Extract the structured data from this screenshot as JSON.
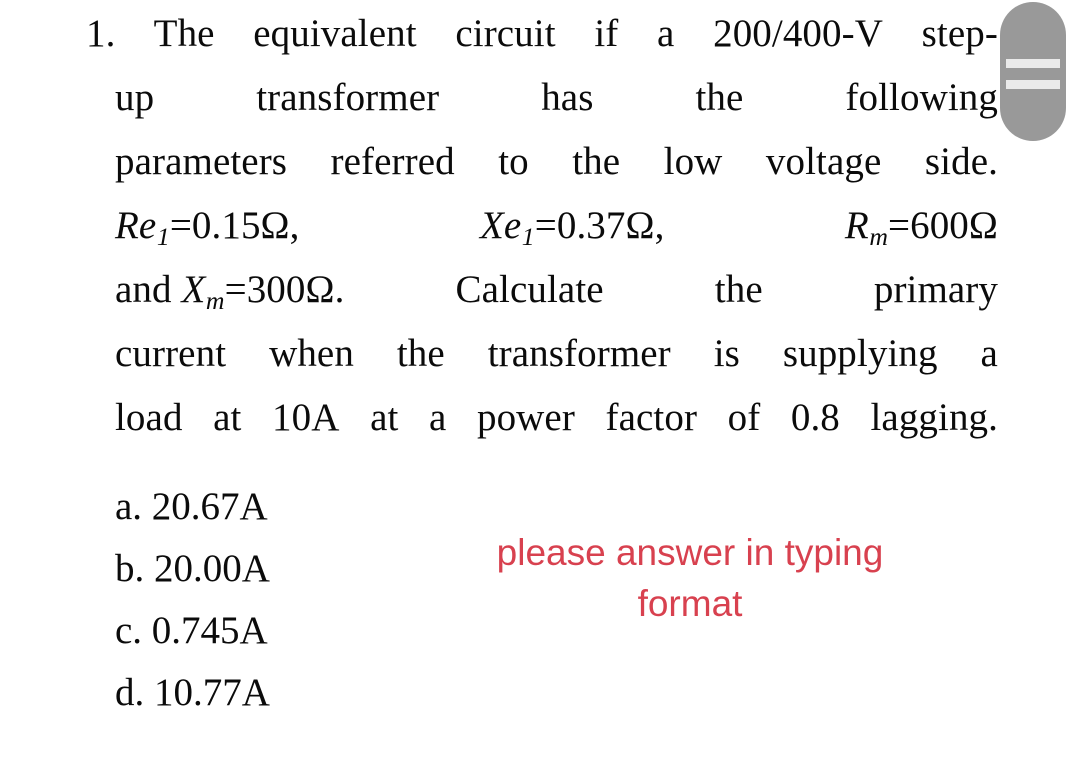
{
  "page": {
    "background_color": "#ffffff",
    "text_color": "#0b0b0b"
  },
  "question": {
    "marker": "1.",
    "lines": [
      {
        "id": "line-1",
        "text": "The equivalent circuit if a 200/400-V step-",
        "words": [
          "The",
          "equivalent",
          "circuit",
          "if",
          "a",
          "200/400-V",
          "step-"
        ]
      },
      {
        "id": "line-2",
        "text": "up transformer has the following",
        "words": [
          "up",
          "transformer",
          "has",
          "the",
          "following"
        ]
      },
      {
        "id": "line-3",
        "text": "parameters referred to the low voltage side.",
        "words": [
          "parameters",
          "referred",
          "to",
          "the",
          "low",
          "voltage",
          "side."
        ]
      },
      {
        "id": "line-4",
        "text": "Re1=0.15Ω, Xe1=0.37Ω, Rm=600Ω",
        "terms": [
          {
            "base": "Re",
            "sub": "1",
            "value": "=0.15Ω,"
          },
          {
            "base": "Xe",
            "sub": "1",
            "value": "=0.37Ω,"
          },
          {
            "base": "R",
            "sub": "m",
            "value": "=600Ω"
          }
        ]
      },
      {
        "id": "line-5",
        "text": "and Xm=300Ω. Calculate the primary",
        "lead": "and",
        "term": {
          "base": "X",
          "sub": "m",
          "value": "=300Ω."
        },
        "words": [
          "Calculate",
          "the",
          "primary"
        ]
      },
      {
        "id": "line-6",
        "text": "current when the transformer is supplying a",
        "words": [
          "current",
          "when",
          "the",
          "transformer",
          "is",
          "supplying",
          "a"
        ]
      },
      {
        "id": "line-7",
        "text": "load at 10A at a power factor of 0.8 lagging.",
        "words": [
          "load",
          "at",
          "10A",
          "at",
          "a",
          "power",
          "factor",
          "of",
          "0.8",
          "lagging."
        ]
      }
    ],
    "given": {
      "Re1": "0.15Ω",
      "Xe1": "0.37Ω",
      "Rm": "600Ω",
      "Xm": "300Ω",
      "transformer_rating": "200/400-V step-up",
      "load_current": "10A",
      "power_factor": "0.8 lagging"
    }
  },
  "options": [
    {
      "label": "a.",
      "value": "20.67A",
      "text": "a. 20.67A"
    },
    {
      "label": "b.",
      "value": "20.00A",
      "text": "b. 20.00A"
    },
    {
      "label": "c.",
      "value": "0.745A",
      "text": "c. 0.745A"
    },
    {
      "label": "d.",
      "value": "10.77A",
      "text": "d. 10.77A"
    }
  ],
  "annotation": {
    "line1": "please answer in typing",
    "line2": "format",
    "color": "#d8414f"
  },
  "overlay_handle": {
    "name": "drag-handle",
    "fill_color": "#999999",
    "bar_color": "#eaeaea",
    "bar_count": 2
  }
}
